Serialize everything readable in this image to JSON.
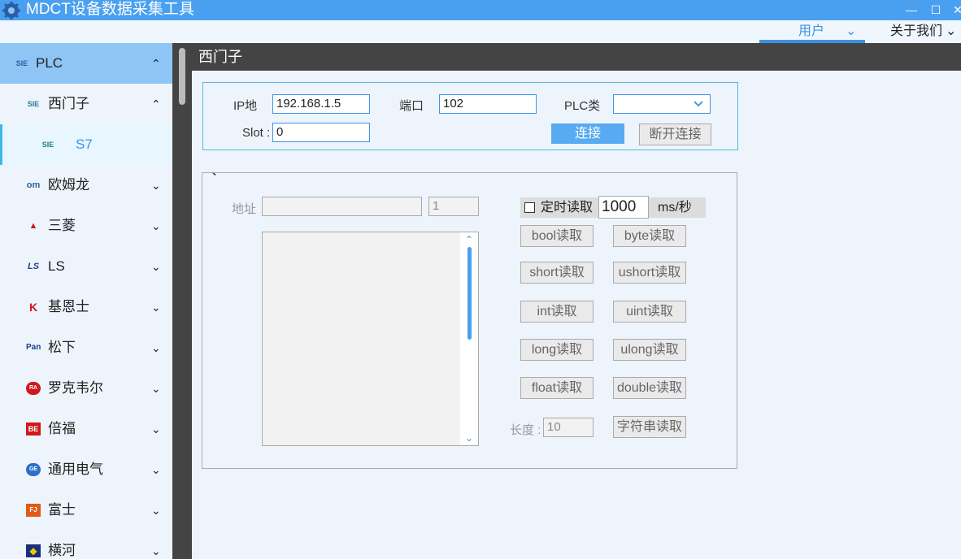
{
  "window": {
    "title": "MDCT设备数据采集工具",
    "minimize": "—",
    "maximize": "☐",
    "close": "✕"
  },
  "menu": {
    "user": "用户",
    "about": "关于我们",
    "chevron": "⌄"
  },
  "sidebar": {
    "header": {
      "label": "PLC",
      "icon": "SIE"
    },
    "items": [
      {
        "label": "西门子",
        "icon": "SIE",
        "icon_name": "siemens-icon",
        "expanded": true
      },
      {
        "label": "S7",
        "icon": "SIE",
        "icon_name": "siemens-icon",
        "selected": true
      },
      {
        "label": "欧姆龙",
        "icon": "om",
        "icon_name": "omron-icon"
      },
      {
        "label": "三菱",
        "icon": "▲",
        "icon_name": "mitsubishi-icon"
      },
      {
        "label": "LS",
        "icon": "LS",
        "icon_name": "ls-icon"
      },
      {
        "label": "基恩士",
        "icon": "K",
        "icon_name": "keyence-icon"
      },
      {
        "label": "松下",
        "icon": "Pan",
        "icon_name": "panasonic-icon"
      },
      {
        "label": "罗克韦尔",
        "icon": "RA",
        "icon_name": "rockwell-icon"
      },
      {
        "label": "倍福",
        "icon": "BE",
        "icon_name": "beckhoff-icon"
      },
      {
        "label": "通用电气",
        "icon": "GE",
        "icon_name": "ge-icon"
      },
      {
        "label": "富士",
        "icon": "FJ",
        "icon_name": "fuji-icon"
      },
      {
        "label": "横河",
        "icon": "◆",
        "icon_name": "yokogawa-icon"
      }
    ],
    "chevron_up": "⌃",
    "chevron_down": "⌄"
  },
  "main": {
    "title": "西门子",
    "connection": {
      "ip_label": "IP地",
      "ip_value": "192.168.1.5",
      "port_label": "端口",
      "port_value": "102",
      "plc_type_label": "PLC类",
      "plc_type_value": "",
      "slot_label": "Slot :",
      "slot_value": "0",
      "connect_button": "连接",
      "disconnect_button": "断开连接"
    },
    "read": {
      "group_label": "、",
      "address_label": "地址",
      "address_value": "",
      "count_value": "1",
      "output_text": "",
      "timer_checkbox_label": "定时读取",
      "timer_value": "1000",
      "timer_unit": "ms/秒",
      "buttons": [
        "bool读取",
        "byte读取",
        "short读取",
        "ushort读取",
        "int读取",
        "uint读取",
        "long读取",
        "ulong读取",
        "float读取",
        "double读取"
      ],
      "length_label": "长度 :",
      "length_value": "10",
      "string_button": "字符串读取"
    }
  }
}
